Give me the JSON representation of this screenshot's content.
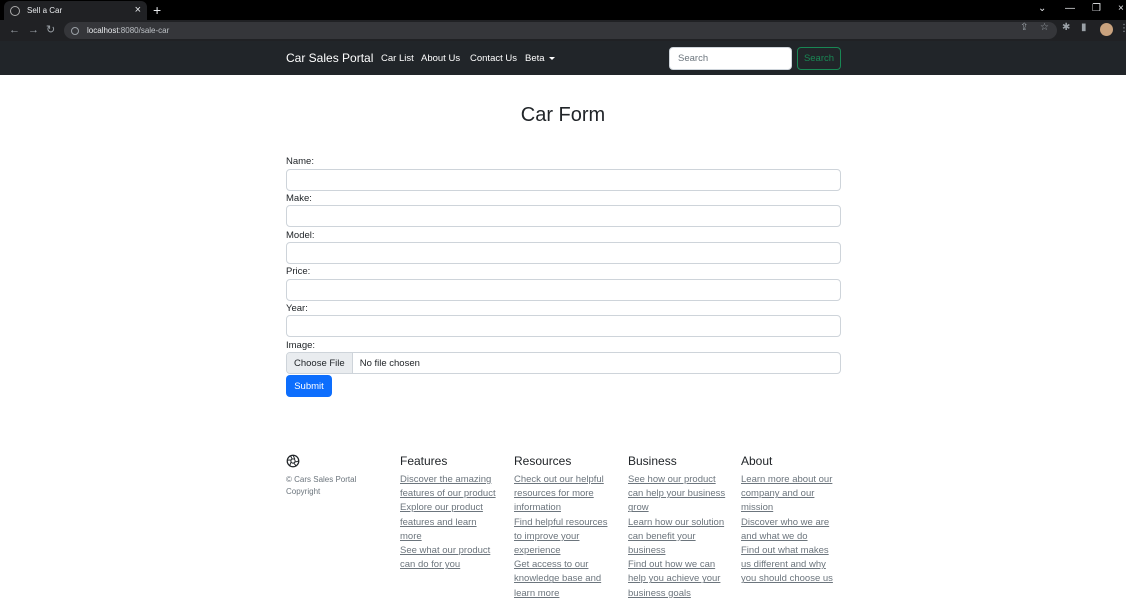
{
  "browser": {
    "tab_title": "Sell a Car",
    "url_host": "localhost",
    "url_rest": ":8080/sale-car"
  },
  "navbar": {
    "brand": "Car Sales Portal",
    "links": [
      "Car List",
      "About Us",
      "Contact Us",
      "Beta"
    ],
    "search_placeholder": "Search",
    "search_button": "Search"
  },
  "form": {
    "title": "Car Form",
    "labels": [
      "Name:",
      "Make:",
      "Model:",
      "Price:",
      "Year:",
      "Image:"
    ],
    "file_button": "Choose File",
    "file_status": "No file chosen",
    "submit": "Submit"
  },
  "footer": {
    "copyright": "© Cars Sales Portal Copyright",
    "columns": [
      {
        "heading": "Features",
        "links": [
          "Discover the amazing features of our product",
          "Explore our product features and learn more",
          "See what our product can do for you"
        ]
      },
      {
        "heading": "Resources",
        "links": [
          "Check out our helpful resources for more information",
          "Find helpful resources to improve your experience",
          "Get access to our knowledge base and learn more"
        ]
      },
      {
        "heading": "Business",
        "links": [
          "See how our product can help your business grow",
          "Learn how our solution can benefit your business",
          "Find out how we can help you achieve your business goals"
        ]
      },
      {
        "heading": "About",
        "links": [
          "Learn more about our company and our mission",
          "Discover who we are and what we do",
          "Find out what makes us different and why you should choose us"
        ]
      }
    ]
  }
}
